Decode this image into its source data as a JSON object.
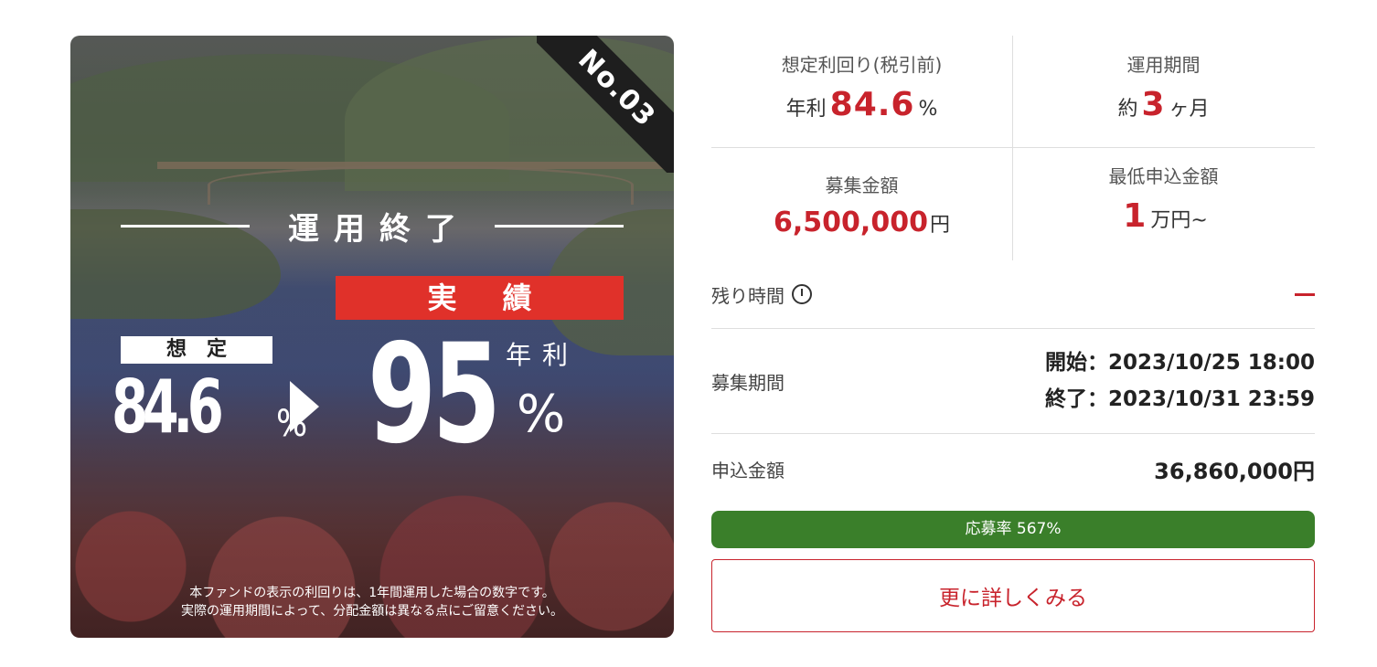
{
  "hero": {
    "fund_number": "No.03",
    "status": "運用終了",
    "result_label": "実績",
    "expected_label": "想定",
    "expected_value": "84.6",
    "expected_unit": "%",
    "actual_value": "95",
    "annual_label": "年利",
    "actual_unit": "%",
    "note_line1": "本ファンドの表示の利回りは、1年間運用した場合の数字です。",
    "note_line2": "実際の運用期間によって、分配金額は異なる点にご留意ください。"
  },
  "summary": {
    "yield": {
      "label": "想定利回り(税引前)",
      "prefix": "年利",
      "value": "84.6",
      "unit": "%"
    },
    "term": {
      "label": "運用期間",
      "prefix": "約",
      "value": "3",
      "unit": "ヶ月"
    },
    "raise": {
      "label": "募集金額",
      "value": "6,500,000",
      "unit": "円"
    },
    "minimum": {
      "label": "最低申込金額",
      "value": "1",
      "unit": "万円~"
    }
  },
  "remaining": {
    "label": "残り時間",
    "icon": "clock-icon",
    "value": "dash"
  },
  "period": {
    "label": "募集期間",
    "start": "開始：2023/10/25 18:00",
    "end": "終了：2023/10/31 23:59"
  },
  "applied": {
    "label": "申込金額",
    "value": "36,860,000円"
  },
  "progress": {
    "label": "応募率 567%",
    "percent": 567
  },
  "detail_button": {
    "label": "更に詳しくみる"
  },
  "colors": {
    "accent": "#c8232c",
    "result_red": "#e0312a",
    "progress_green": "#3a7f2a",
    "ribbon": "#1e1e1e"
  }
}
